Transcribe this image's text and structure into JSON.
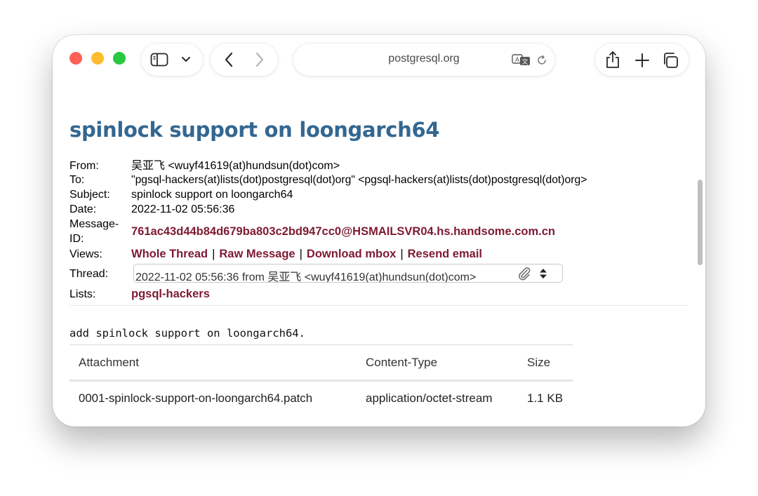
{
  "browser": {
    "address": "postgresql.org",
    "colors": {
      "close": "#fe5f57",
      "minimize": "#febc2e",
      "zoom": "#28c840"
    }
  },
  "message": {
    "title": "spinlock support on loongarch64",
    "fields": {
      "from_label": "From:",
      "from_value": "吴亚飞 <wuyf41619(at)hundsun(dot)com>",
      "to_label": "To:",
      "to_value": "\"pgsql-hackers(at)lists(dot)postgresql(dot)org\" <pgsql-hackers(at)lists(dot)postgresql(dot)org>",
      "subject_label": "Subject:",
      "subject_value": "spinlock support on loongarch64",
      "date_label": "Date:",
      "date_value": "2022-11-02 05:56:36",
      "msgid_label_line1": "Message-",
      "msgid_label_line2": "ID:",
      "msgid_value": "761ac43d44b84d679ba803c2bd947cc0@HSMAILSVR04.hs.handsome.com.cn",
      "views_label": "Views:",
      "thread_label": "Thread:",
      "thread_value": "2022-11-02 05:56:36 from 吴亚飞 <wuyf41619(at)hundsun(dot)com>",
      "lists_label": "Lists:",
      "lists_value": "pgsql-hackers"
    },
    "views": {
      "whole_thread": "Whole Thread",
      "raw_message": "Raw Message",
      "download_mbox": "Download mbox",
      "resend_email": "Resend email",
      "separator": "|"
    },
    "body": "add spinlock support on loongarch64.",
    "attachments": {
      "headers": [
        "Attachment",
        "Content-Type",
        "Size"
      ],
      "rows": [
        {
          "name": "0001-spinlock-support-on-loongarch64.patch",
          "content_type": "application/octet-stream",
          "size": "1.1 KB"
        }
      ]
    },
    "link_color": "#7e1a33",
    "title_color": "#336791"
  }
}
